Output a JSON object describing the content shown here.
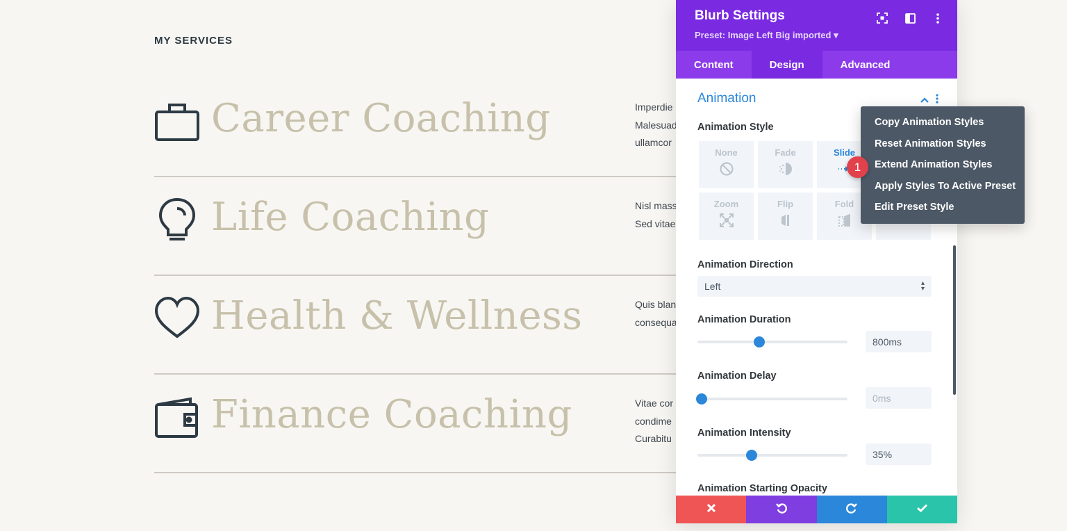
{
  "page": {
    "section_label": "MY SERVICES",
    "services": [
      {
        "title": "Career Coaching",
        "icon": "briefcase-icon",
        "desc": [
          "Imperdie",
          "Malesuad",
          "ullamcor"
        ]
      },
      {
        "title": "Life Coaching",
        "icon": "lightbulb-icon",
        "desc": [
          "Nisl mass",
          "Sed vitae"
        ]
      },
      {
        "title": "Health & Wellness",
        "icon": "heart-icon",
        "desc": [
          "Quis blan",
          "consequa"
        ]
      },
      {
        "title": "Finance Coaching",
        "icon": "wallet-icon",
        "desc": [
          "Vitae cor",
          "condime",
          "Curabitu"
        ]
      }
    ]
  },
  "panel": {
    "title": "Blurb Settings",
    "preset": "Preset: Image Left Big imported ▾",
    "header_icons": [
      "focus-icon",
      "split-view-icon",
      "more-vertical-icon"
    ],
    "tabs": [
      {
        "label": "Content"
      },
      {
        "label": "Design"
      },
      {
        "label": "Advanced"
      }
    ],
    "active_tab": "Design",
    "section_title": "Animation",
    "animation_style_label": "Animation Style",
    "animation_styles": [
      {
        "label": "None",
        "icon": "none-icon"
      },
      {
        "label": "Fade",
        "icon": "fade-icon"
      },
      {
        "label": "Slide",
        "icon": "slide-icon",
        "selected": true
      },
      {
        "label": "",
        "icon": "bounce-icon"
      },
      {
        "label": "Zoom",
        "icon": "zoom-icon"
      },
      {
        "label": "Flip",
        "icon": "flip-icon"
      },
      {
        "label": "Fold",
        "icon": "fold-icon"
      },
      {
        "label": "",
        "icon": "roll-icon"
      }
    ],
    "direction": {
      "label": "Animation Direction",
      "value": "Left"
    },
    "duration": {
      "label": "Animation Duration",
      "value": "800ms",
      "level": 0.41
    },
    "delay": {
      "label": "Animation Delay",
      "value": "0ms",
      "level": 0.03
    },
    "intensity": {
      "label": "Animation Intensity",
      "value": "35%",
      "level": 0.36
    },
    "starting_opacity_label": "Animation Starting Opacity",
    "footer": {
      "buttons": [
        {
          "name": "cancel-button",
          "icon": "close-icon",
          "color": "#ef5555"
        },
        {
          "name": "undo-button",
          "icon": "undo-icon",
          "color": "#7f3ee0"
        },
        {
          "name": "redo-button",
          "icon": "redo-icon",
          "color": "#2b87da"
        },
        {
          "name": "save-button",
          "icon": "check-icon",
          "color": "#29c4a9"
        }
      ]
    }
  },
  "context_menu": {
    "items": [
      "Copy Animation Styles",
      "Reset Animation Styles",
      "Extend Animation Styles",
      "Apply Styles To Active Preset",
      "Edit Preset Style"
    ]
  },
  "badge": {
    "number": "1",
    "color": "#e1414b"
  },
  "colors": {
    "header": "#7a2ae1",
    "tabs": "#8c3bea",
    "accent": "#2b87da",
    "menu": "#4c5866",
    "title_text": "#c7c1ab"
  }
}
